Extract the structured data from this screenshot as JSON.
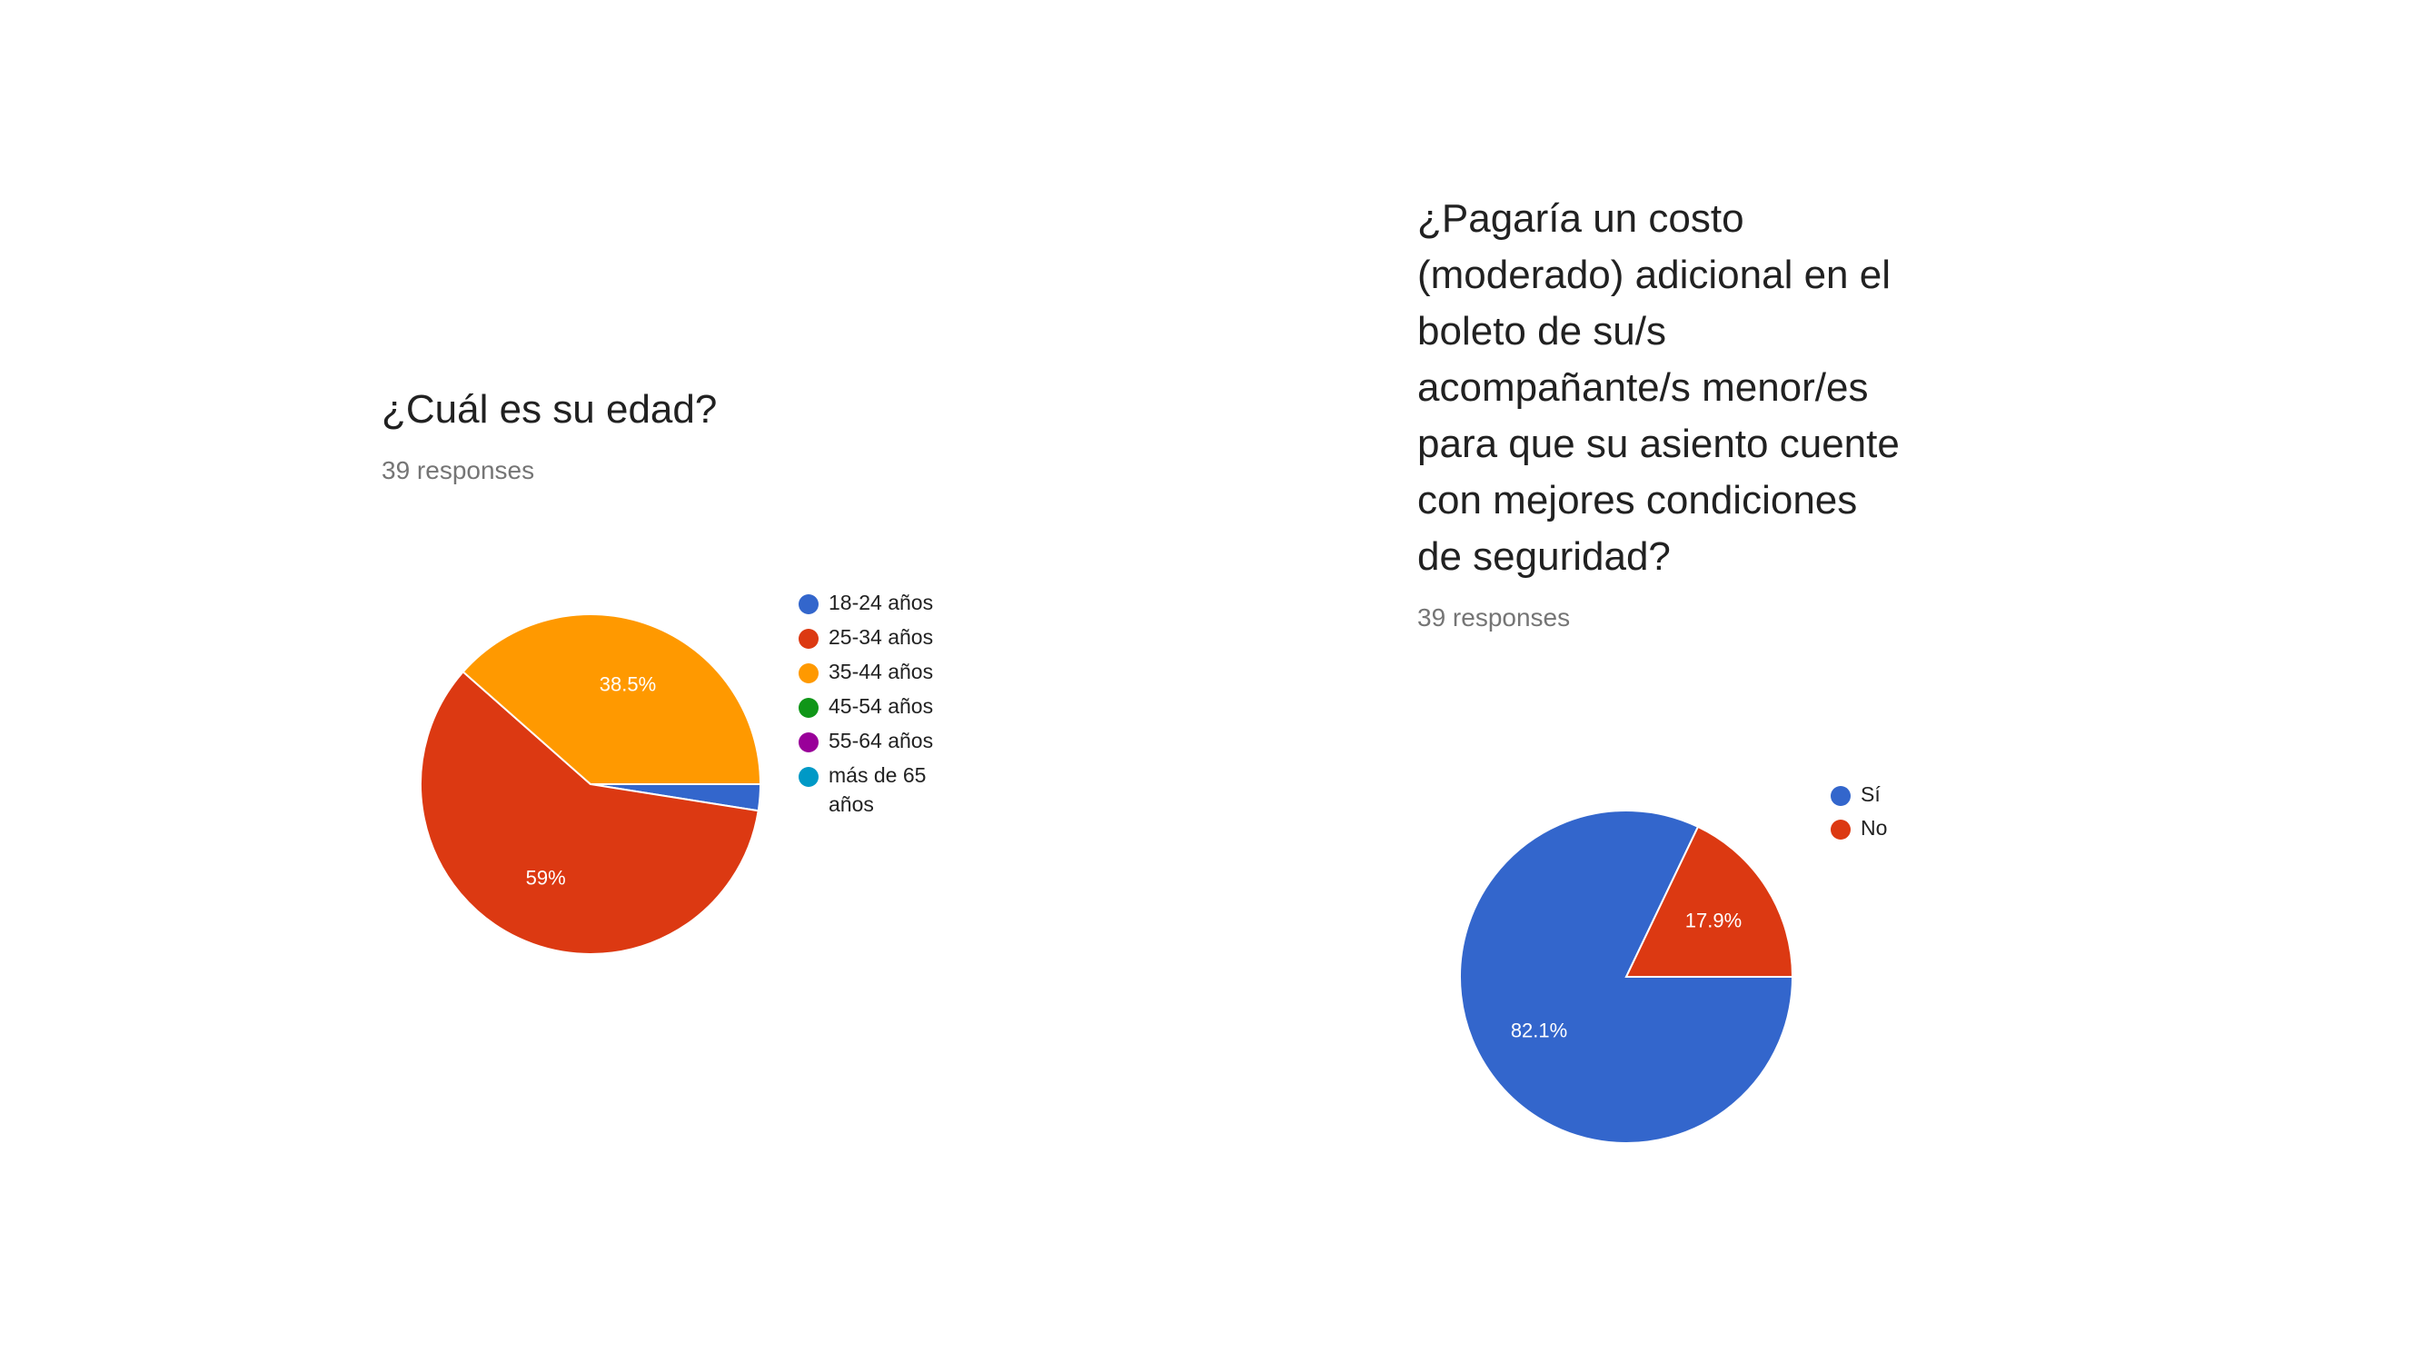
{
  "charts": [
    {
      "title": "¿Cuál es su edad?",
      "subtitle": "39 responses"
    },
    {
      "title": "¿Pagaría un costo (moderado) adicional en el boleto de su/s acompañante/s menor/es para que su asiento cuente con mejores condiciones de seguridad?",
      "subtitle": "39 responses"
    }
  ],
  "chart_data": [
    {
      "type": "pie",
      "title": "¿Cuál es su edad?",
      "subtitle": "39 responses",
      "slices": [
        {
          "label": "18-24 años",
          "value": 2.5,
          "display": "",
          "color": "#3366cc",
          "legend_lines": [
            "18-24 años"
          ]
        },
        {
          "label": "25-34 años",
          "value": 59,
          "display": "59%",
          "color": "#dc3912",
          "legend_lines": [
            "25-34 años"
          ]
        },
        {
          "label": "35-44 años",
          "value": 38.5,
          "display": "38.5%",
          "color": "#ff9900",
          "legend_lines": [
            "35-44 años"
          ]
        },
        {
          "label": "45-54 años",
          "value": 0,
          "display": "",
          "color": "#109618",
          "legend_lines": [
            "45-54 años"
          ]
        },
        {
          "label": "55-64 años",
          "value": 0,
          "display": "",
          "color": "#990099",
          "legend_lines": [
            "55-64 años"
          ]
        },
        {
          "label": "más de 65 años",
          "value": 0,
          "display": "",
          "color": "#0099c6",
          "legend_lines": [
            "más de 65",
            "años"
          ]
        }
      ],
      "legend_position": "right"
    },
    {
      "type": "pie",
      "title": "¿Pagaría un costo (moderado) adicional en el boleto de su/s acompañante/s menor/es para que su asiento cuente con mejores condiciones de seguridad?",
      "subtitle": "39 responses",
      "slices": [
        {
          "label": "Sí",
          "value": 82.1,
          "display": "82.1%",
          "color": "#3366cc",
          "legend_lines": [
            "Sí"
          ]
        },
        {
          "label": "No",
          "value": 17.9,
          "display": "17.9%",
          "color": "#dc3912",
          "legend_lines": [
            "No"
          ]
        }
      ],
      "legend_position": "right"
    }
  ]
}
